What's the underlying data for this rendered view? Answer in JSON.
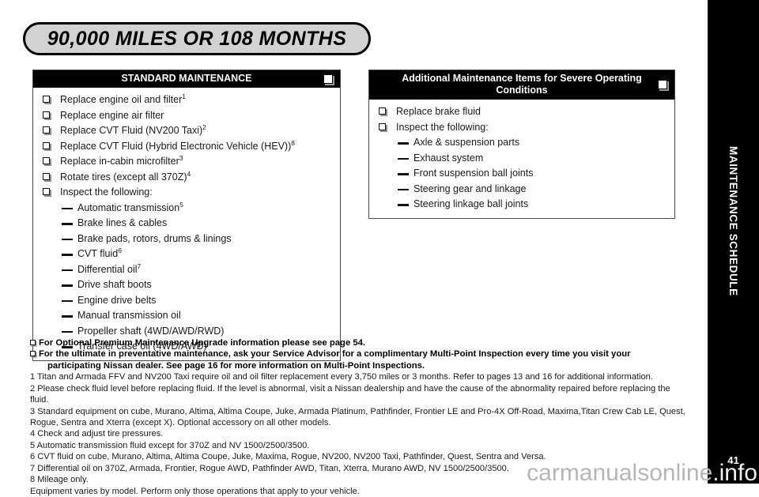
{
  "banner": {
    "title": "90,000 MILES OR 108 MONTHS"
  },
  "standard_panel": {
    "header": "STANDARD MAINTENANCE",
    "items": [
      {
        "label": "Replace engine oil and filter",
        "sup": "1"
      },
      {
        "label": "Replace engine air filter",
        "sup": ""
      },
      {
        "label": "Replace CVT Fluid (NV200 Taxi)",
        "sup": "2"
      },
      {
        "label": "Replace CVT Fluid (Hybrid Electronic Vehicle (HEV))",
        "sup": "8"
      },
      {
        "label": "Replace in-cabin microfilter",
        "sup": "3"
      },
      {
        "label": "Rotate tires (except all 370Z)",
        "sup": "4"
      },
      {
        "label": "Inspect the following:",
        "sup": ""
      }
    ],
    "subitems": [
      {
        "label": "Automatic transmission",
        "sup": "5"
      },
      {
        "label": "Brake lines & cables",
        "sup": ""
      },
      {
        "label": "Brake pads, rotors, drums & linings",
        "sup": ""
      },
      {
        "label": "CVT fluid",
        "sup": "6"
      },
      {
        "label": "Differential oil",
        "sup": "7"
      },
      {
        "label": "Drive shaft boots",
        "sup": ""
      },
      {
        "label": "Engine drive belts",
        "sup": ""
      },
      {
        "label": "Manual transmission oil",
        "sup": ""
      },
      {
        "label": "Propeller shaft (4WD/AWD/RWD)",
        "sup": ""
      },
      {
        "label": "Transfer case oil (4WD/AWD)",
        "sup": ""
      }
    ]
  },
  "severe_panel": {
    "header_line1": "Additional Maintenance Items for Severe Operating",
    "header_line2": "Conditions",
    "items": [
      {
        "label": "Replace brake fluid",
        "sup": ""
      },
      {
        "label": "Inspect the following:",
        "sup": ""
      }
    ],
    "subitems": [
      {
        "label": "Axle & suspension parts",
        "sup": ""
      },
      {
        "label": "Exhaust system",
        "sup": ""
      },
      {
        "label": "Front suspension ball joints",
        "sup": ""
      },
      {
        "label": "Steering gear and linkage",
        "sup": ""
      },
      {
        "label": "Steering linkage ball joints",
        "sup": ""
      }
    ]
  },
  "notes": {
    "bold_note_1": "For Optional Premium Maintenance Upgrade information please see page 54.",
    "bold_note_2": "For the ultimate in preventative maintenance, ask your Service Advisor for a complimentary Multi-Point Inspection every time you visit your",
    "bold_note_2_cont": "participating Nissan dealer. See page 16 for more information on Multi-Point Inspections.",
    "footnotes": [
      "1 Titan and Armada FFV and NV200 Taxi require oil and oil filter replacement every 3,750 miles or 3 months. Refer to pages 13 and 16 for additional information.",
      "2 Please check fluid level before replacing fluid. If the level is abnormal, visit a Nissan dealership and have the cause of the abnormality repaired before replacing the fluid.",
      "3 Standard equipment on cube, Murano, Altima, Altima Coupe, Juke, Armada Platinum, Pathfinder, Frontier LE and Pro-4X Off-Road, Maxima,Titan Crew Cab LE, Quest, Rogue, Sentra and Xterra (except X). Optional accessory on all other models.",
      "4 Check and adjust tire pressures.",
      "5 Automatic transmission fluid except for 370Z and NV 1500/2500/3500.",
      "6 CVT fluid on cube, Murano, Altima, Altima Coupe, Juke, Maxima, Rogue, NV200, NV200 Taxi, Pathfinder, Quest, Sentra and Versa.",
      "7 Differential oil on 370Z, Armada, Frontier, Rogue AWD, Pathfinder AWD, Titan, Xterra, Murano AWD, NV 1500/2500/3500.",
      "8 Mileage only.",
      "Equipment varies by model. Perform only those operations that apply to your vehicle."
    ]
  },
  "sidebar": {
    "label": "MAINTENANCE SCHEDULE",
    "page_number": "41"
  },
  "watermark": {
    "text_main": "carmanualsonline",
    "text_tail": ".info"
  }
}
